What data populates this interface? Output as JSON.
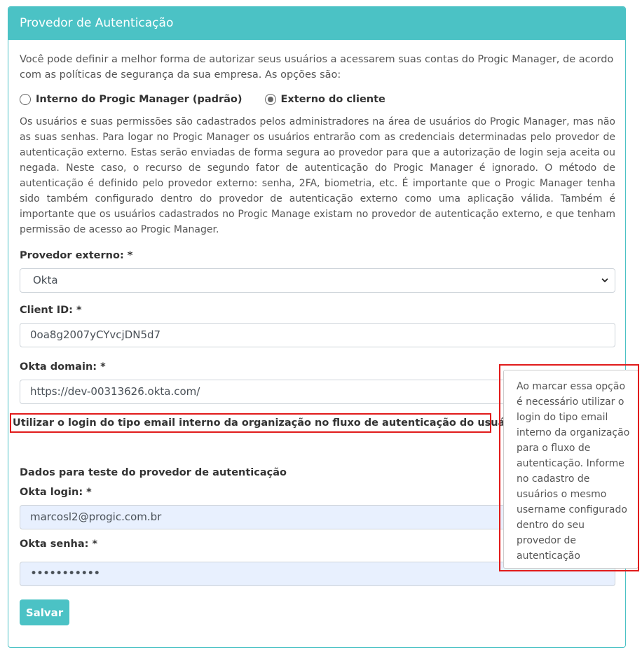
{
  "header": {
    "title": "Provedor de Autenticação"
  },
  "intro": "Você pode definir a melhor forma de autorizar seus usuários a acessarem suas contas do Progic Manager, de acordo com as políticas de segurança da sua empresa. As opções são:",
  "auth_options": {
    "internal_label": "Interno do Progic Manager (padrão)",
    "external_label": "Externo do cliente",
    "selected": "Externo do cliente"
  },
  "description": "Os usuários e suas permissões são cadastrados pelos administradores na área de usuários do Progic Manager, mas não as suas senhas. Para logar no Progic Manager os usuários entrarão com as credenciais determinadas pelo provedor de autenticação externo. Estas serão enviadas de forma segura ao provedor para que a autorização de login seja aceita ou negada. Neste caso, o recurso de segundo fator de autenticação do Progic Manager é ignorado. O método de autenticação é definido pelo provedor externo: senha, 2FA, biometria, etc. É importante que o Progic Manager tenha sido também configurado dentro do provedor de autenticação externo como uma aplicação válida. Também é importante que os usuários cadastrados no Progic Manage existam no provedor de autenticação externo, e que tenham permissão de acesso ao Progic Manager.",
  "form": {
    "provider_label": "Provedor externo: *",
    "provider_value": "Okta",
    "client_id_label": "Client ID: *",
    "client_id_value": "0oa8g2007yCYvcjDN5d7",
    "domain_label": "Okta domain: *",
    "domain_value": "https://dev-00313626.okta.com/",
    "email_login_label": "Utilizar o login do tipo email interno da organização no fluxo de autenticação do usuário:",
    "email_login_checked": true,
    "test_section_title": "Dados para teste do provedor de autenticação",
    "okta_login_label": "Okta login: *",
    "okta_login_value": "marcosl2@progic.com.br",
    "okta_password_label": "Okta senha: *",
    "okta_password_value": "•••••••••••",
    "save_label": "Salvar"
  },
  "tooltip": {
    "text": "Ao marcar essa opção é necessário utilizar o login do tipo email interno da organização para o fluxo de autenticação. Informe no cadastro de usuários o mesmo username configurado dentro do seu provedor de autenticação"
  },
  "icons": {
    "checkbox": "checkbox-checked-icon",
    "help": "question-circle-icon",
    "select": "chevron-down-icon"
  },
  "colors": {
    "accent": "#4bc2c5",
    "highlight": "#e11b1b",
    "autofill": "#e8f0fe"
  }
}
